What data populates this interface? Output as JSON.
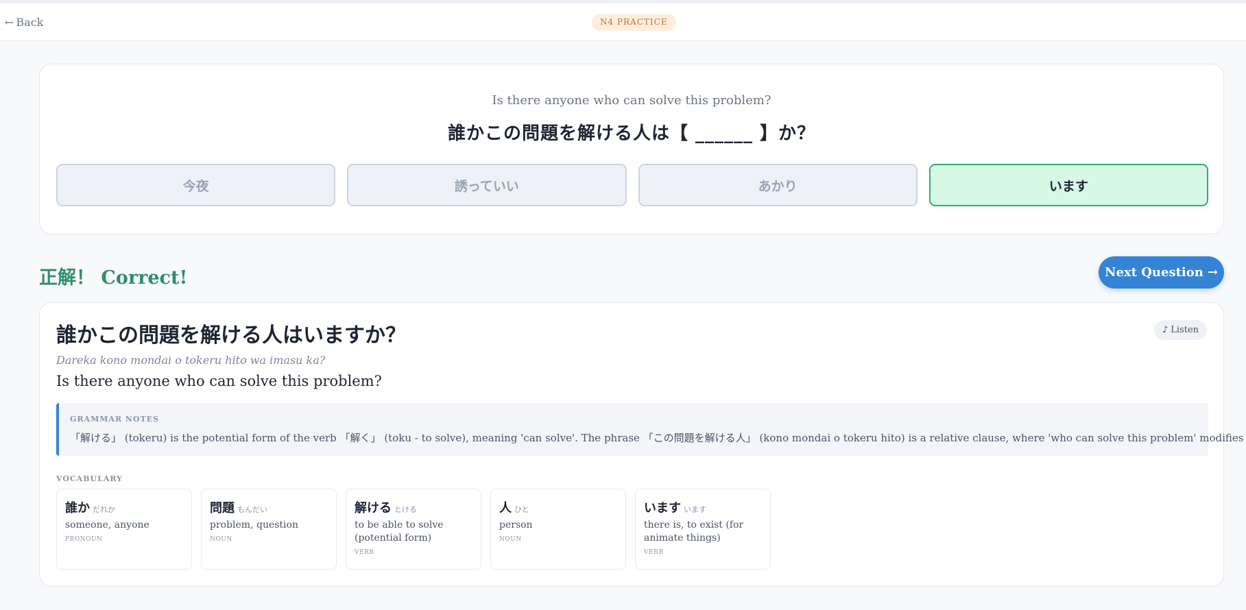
{
  "header": {
    "back_arrow": "←",
    "back_label": "Back",
    "level_badge": "N4 PRACTICE"
  },
  "question": {
    "english": "Is there anyone who can solve this problem?",
    "japanese": "誰かこの問題を解ける人は【 ______ 】か？",
    "options": [
      {
        "label": "今夜",
        "state": "dimmed"
      },
      {
        "label": "誘っていい",
        "state": "dimmed"
      },
      {
        "label": "あかり",
        "state": "dimmed"
      },
      {
        "label": "います",
        "state": "correct"
      }
    ]
  },
  "result": {
    "message": "正解！ Correct!",
    "next_label": "Next Question",
    "next_arrow": "→"
  },
  "detail": {
    "sentence_jp": "誰かこの問題を解ける人はいますか？",
    "romaji": "Dareka kono mondai o tokeru hito wa imasu ka?",
    "sentence_en": "Is there anyone who can solve this problem?",
    "listen_icon": "♪",
    "listen_label": "Listen",
    "grammar_title": "GRAMMAR NOTES",
    "grammar_text": "「解ける」 (tokeru) is the potential form of the verb 「解く」 (toku - to solve), meaning 'can solve'. The phrase 「この問題を解ける人」 (kono mondai o tokeru hito) is a relative clause, where 'who can solve this problem' modifies 'person'.",
    "vocab_title": "VOCABULARY",
    "vocab": [
      {
        "word": "誰か",
        "reading": "だれか",
        "meaning": "someone, anyone",
        "pos": "PRONOUN"
      },
      {
        "word": "問題",
        "reading": "もんだい",
        "meaning": "problem, question",
        "pos": "NOUN"
      },
      {
        "word": "解ける",
        "reading": "とける",
        "meaning": "to be able to solve (potential form)",
        "pos": "VERB"
      },
      {
        "word": "人",
        "reading": "ひと",
        "meaning": "person",
        "pos": "NOUN"
      },
      {
        "word": "います",
        "reading": "います",
        "meaning": "there is, to exist (for animate things)",
        "pos": "VERB"
      }
    ]
  },
  "colors": {
    "accent": "#3583d4",
    "correct_green": "#2fae6b",
    "correct_bg": "#d7f8e5",
    "badge_bg": "#fdeedc",
    "badge_text": "#c2703a"
  }
}
